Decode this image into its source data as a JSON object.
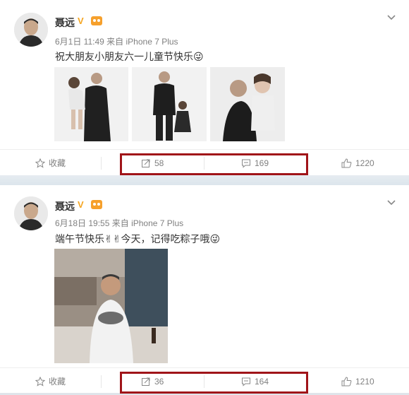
{
  "posts": [
    {
      "name": "聂远",
      "vip": "V",
      "date": "6月1日 11:49",
      "source": "来自 iPhone 7 Plus",
      "text": "祝大朋友小朋友六一儿童节快乐😜",
      "actions": {
        "favorite": "收藏",
        "repost": "58",
        "comment": "169",
        "like": "1220"
      }
    },
    {
      "name": "聂远",
      "vip": "V",
      "date": "6月18日 19:55",
      "source": "来自 iPhone 7 Plus",
      "text": "端午节快乐✌✌今天，记得吃粽子哦😜",
      "actions": {
        "favorite": "收藏",
        "repost": "36",
        "comment": "164",
        "like": "1210"
      }
    }
  ],
  "colors": {
    "highlight": "#a01419",
    "vip": "#f5a623",
    "meta": "#808080"
  }
}
